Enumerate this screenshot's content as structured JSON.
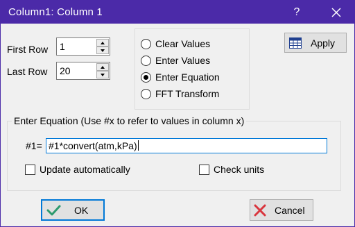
{
  "window": {
    "title": "Column1:  Column 1",
    "help_glyph": "?",
    "close_icon": "close-icon"
  },
  "rows": {
    "first_label": "First Row",
    "first_value": "1",
    "last_label": "Last Row",
    "last_value": "20"
  },
  "mode": {
    "options": [
      "Clear Values",
      "Enter Values",
      "Enter Equation",
      "FFT Transform"
    ],
    "selected": "Enter Equation"
  },
  "apply_button": {
    "label": "Apply",
    "icon": "table-icon"
  },
  "equation": {
    "group_title": "Enter Equation (Use #x to refer to values in column x)",
    "prefix": "#1=",
    "value": "#1*convert(atm,kPa)"
  },
  "options": {
    "update_auto": "Update automatically",
    "check_units": "Check units"
  },
  "buttons": {
    "ok": "OK",
    "cancel": "Cancel"
  },
  "colors": {
    "titlebar": "#4b2aa8",
    "ok_check": "#2e9a6e",
    "cancel_x": "#d9363e",
    "focus": "#0078d7"
  }
}
